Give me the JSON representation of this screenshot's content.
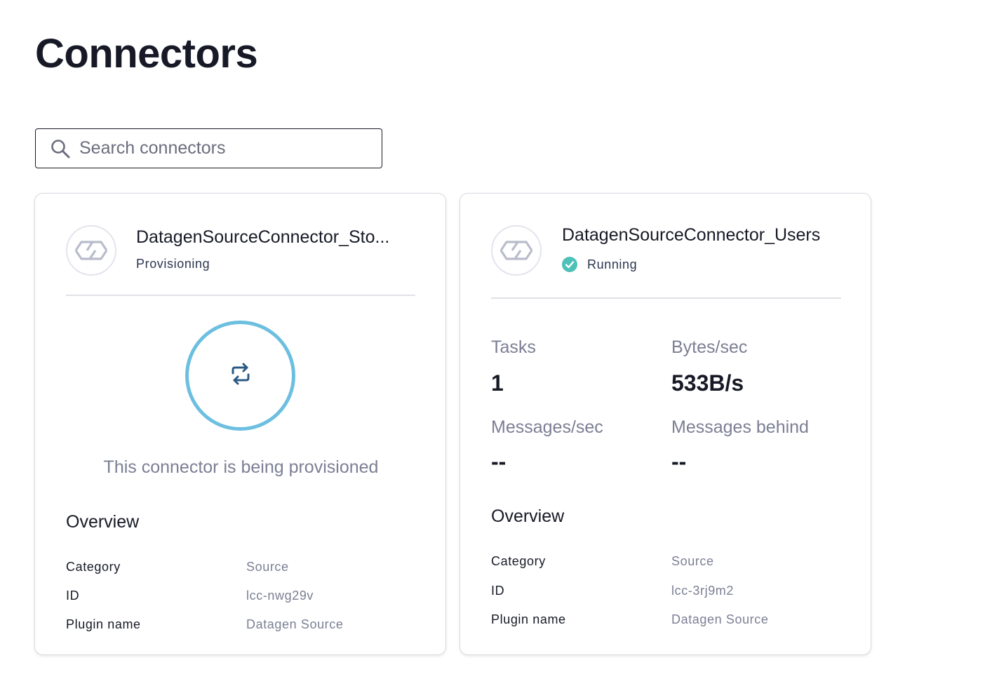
{
  "page": {
    "title": "Connectors"
  },
  "search": {
    "placeholder": "Search connectors",
    "value": ""
  },
  "cards": [
    {
      "name": "DatagenSourceConnector_Sto...",
      "status": "Provisioning",
      "provisioning_message": "This connector is being provisioned",
      "overview": {
        "title": "Overview",
        "rows": [
          {
            "key": "Category",
            "value": "Source"
          },
          {
            "key": "ID",
            "value": "lcc-nwg29v"
          },
          {
            "key": "Plugin name",
            "value": "Datagen Source"
          }
        ]
      }
    },
    {
      "name": "DatagenSourceConnector_Users",
      "status": "Running",
      "metrics": {
        "tasks_label": "Tasks",
        "tasks_value": "1",
        "bytes_label": "Bytes/sec",
        "bytes_value": "533B/s",
        "messages_label": "Messages/sec",
        "messages_value": "--",
        "behind_label": "Messages behind",
        "behind_value": "--"
      },
      "overview": {
        "title": "Overview",
        "rows": [
          {
            "key": "Category",
            "value": "Source"
          },
          {
            "key": "ID",
            "value": "lcc-3rj9m2"
          },
          {
            "key": "Plugin name",
            "value": "Datagen Source"
          }
        ]
      }
    }
  ],
  "colors": {
    "running_badge": "#4fc1b8",
    "provision_ring": "#6cbfe0",
    "provision_icon": "#2c5a86"
  }
}
